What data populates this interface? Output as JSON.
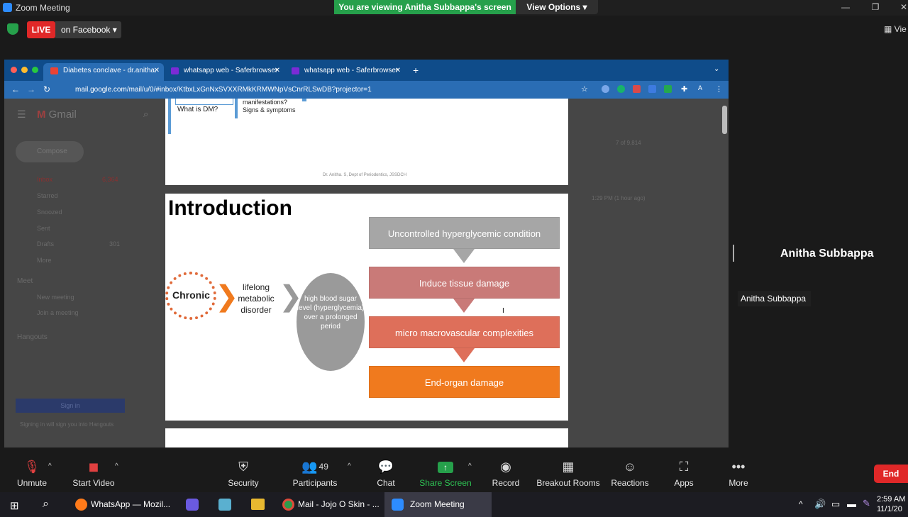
{
  "window": {
    "title": "Zoom Meeting"
  },
  "banner": {
    "viewing": "You are viewing Anitha Subbappa's screen",
    "view_options": "View Options ▾"
  },
  "live": {
    "badge": "LIVE",
    "platform": "on Facebook ▾",
    "view_right": "Vie"
  },
  "browser": {
    "tabs": [
      {
        "label": "Diabetes conclave - dr.anitha.",
        "favicon": "gmail-icon"
      },
      {
        "label": "whatsapp web - Saferbrowser",
        "favicon": "yahoo-icon"
      },
      {
        "label": "whatsapp web - Saferbrowser",
        "favicon": "yahoo-icon"
      }
    ],
    "url": "mail.google.com/mail/u/0/#inbox/KtbxLxGnNxSVXXRMkKRMWNpVsCnrRLSwDB?projector=1"
  },
  "gmail": {
    "logo": "Gmail",
    "compose": "Compose",
    "nav": [
      {
        "label": "Inbox",
        "count": "6,364"
      },
      {
        "label": "Starred",
        "count": ""
      },
      {
        "label": "Snoozed",
        "count": ""
      },
      {
        "label": "Sent",
        "count": ""
      },
      {
        "label": "Drafts",
        "count": "301"
      },
      {
        "label": "More",
        "count": ""
      }
    ],
    "meet_header": "Meet",
    "meet_items": [
      "New meeting",
      "Join a meeting"
    ],
    "hangouts_header": "Hangouts",
    "signin_button": "Sign in",
    "signin_note": "Signing in will sign you into Hangouts",
    "pager": "7 of 9,814",
    "timestamp": "1:29 PM (1 hour ago)"
  },
  "slide1": {
    "box1": "What is DM?",
    "box2": "manifestations? Signs & symptoms",
    "footer": "Dr. Anitha. S, Dept of Periodontics, JSSDCH"
  },
  "slide2": {
    "title": "Introduction",
    "chronic": "Chronic",
    "metabolic": "lifelong metabolic disorder",
    "ellipse": "high blood sugar level (hyperglycemia) over a prolonged period",
    "flow": [
      "Uncontrolled hyperglycemic condition",
      "Induce tissue damage",
      "micro macrovascular complexities",
      "End-organ damage"
    ]
  },
  "participant": {
    "name_big": "Anitha Subbappa",
    "name_tag": "Anitha Subbappa"
  },
  "toolbar": {
    "unmute": "Unmute",
    "start_video": "Start Video",
    "security": "Security",
    "participants": "Participants",
    "participants_count": "49",
    "chat": "Chat",
    "share_screen": "Share Screen",
    "record": "Record",
    "breakout": "Breakout Rooms",
    "reactions": "Reactions",
    "apps": "Apps",
    "more": "More",
    "end": "End"
  },
  "taskbar": {
    "items": [
      "WhatsApp — Mozil...",
      "Mail - Jojo O Skin - ...",
      "Zoom Meeting"
    ],
    "time": "2:59 AM",
    "date": "11/1/20"
  }
}
